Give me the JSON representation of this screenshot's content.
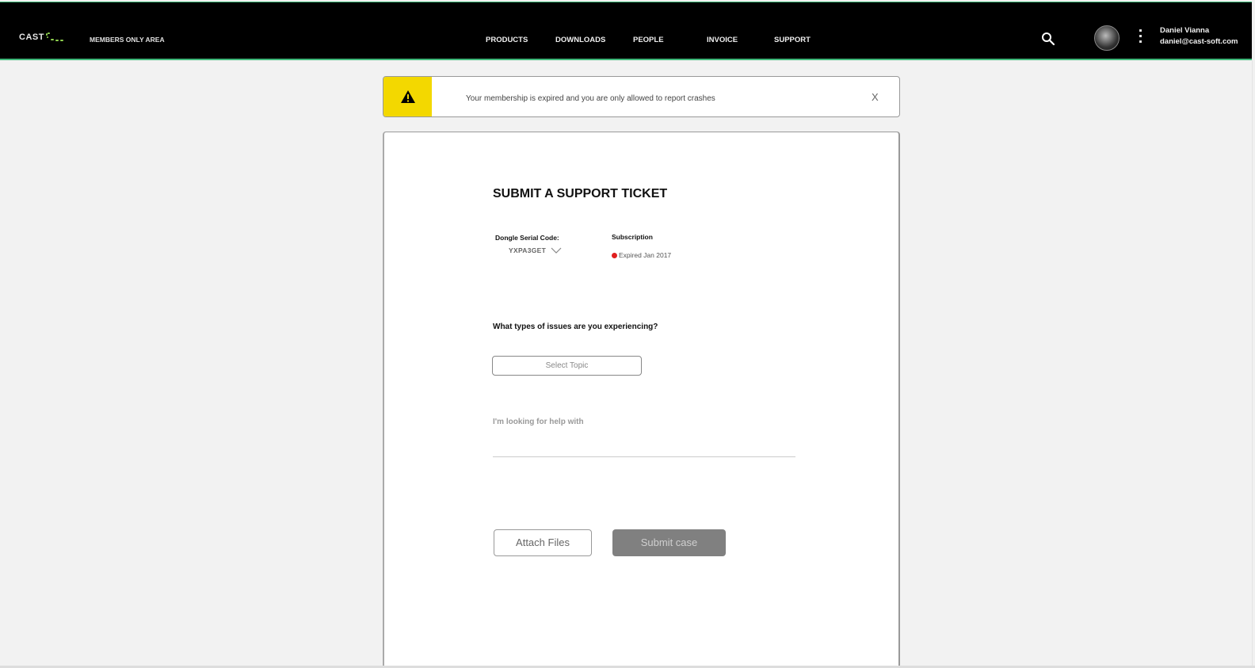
{
  "header": {
    "logo_text": "CAST",
    "members_label": "MEMBERS ONLY AREA",
    "nav": [
      {
        "label": "PRODUCTS"
      },
      {
        "label": "DOWNLOADS"
      },
      {
        "label": "PEOPLE"
      },
      {
        "label": "INVOICE"
      },
      {
        "label": "SUPPORT"
      }
    ],
    "search_icon": "search-icon",
    "menu_icon": "kebab-menu-icon",
    "user": {
      "name": "Daniel Vianna",
      "email": "daniel@cast-soft.com"
    },
    "accent_color": "#3fb87a"
  },
  "alert": {
    "icon": "warning-icon",
    "message": "Your membership is expired and you are only allowed to report crashes",
    "close_label": "X",
    "stripe_color": "#f3d800"
  },
  "form": {
    "title": "SUBMIT A SUPPORT TICKET",
    "dongle_label": "Dongle Serial Code:",
    "dongle_value": "YXPA3GET",
    "subscription_label": "Subscription",
    "subscription_status": "Expired Jan 2017",
    "subscription_status_color": "#e01f1f",
    "question": "What types of issues are you experiencing?",
    "topic_placeholder": "Select Topic",
    "help_placeholder": "I'm looking for help with",
    "attach_label": "Attach Files",
    "submit_label": "Submit case"
  }
}
